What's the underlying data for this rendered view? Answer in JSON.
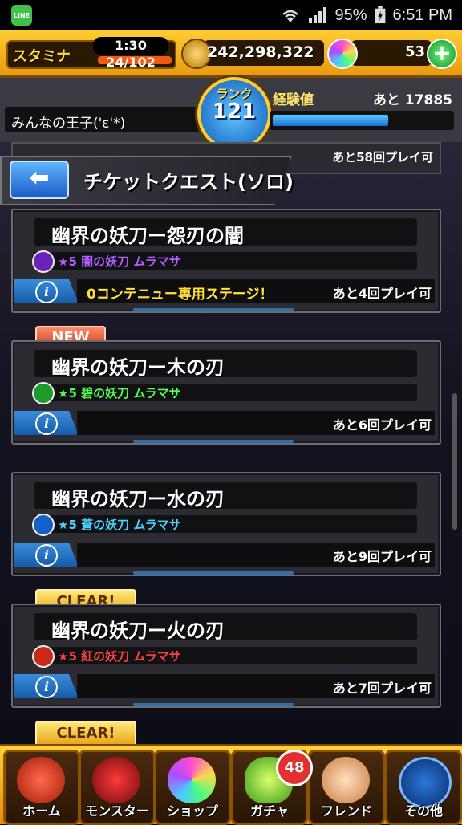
{
  "status_bar": {
    "line_app": "LINE",
    "battery": "95%",
    "time": "6:51 PM"
  },
  "header": {
    "stamina_label": "スタミナ",
    "stamina_timer": "1:30",
    "stamina_value": "24/102",
    "coins": "242,298,322",
    "orbs": "53",
    "plus": "+"
  },
  "user": {
    "name": "みんなの王子('ε'*)",
    "rank_label": "ランク",
    "rank_value": "121",
    "exp_label": "経験値",
    "exp_remaining": "あと 17885",
    "exp_progress": 0.65
  },
  "quest_list": {
    "top_strip_plays": "あと58回プレイ可",
    "back_arrow": "⬅",
    "screen_title": "チケットクエスト(ソロ)",
    "cards": [
      {
        "title": "幽界の妖刀ー怨刃の闇",
        "monster": "★5 闇の妖刀 ムラマサ",
        "element": "dark",
        "element_color": "#b35cff",
        "notice": "0コンテニュー専用ステージ！",
        "plays": "あと4回プレイ可",
        "tag": ""
      },
      {
        "title": "幽界の妖刀ー木の刃",
        "monster": "★5 碧の妖刀 ムラマサ",
        "element": "wood",
        "element_color": "#4dff4d",
        "notice": "",
        "plays": "あと6回プレイ可",
        "tag": "NEW"
      },
      {
        "title": "幽界の妖刀ー水の刃",
        "monster": "★5 蒼の妖刀 ムラマサ",
        "element": "water",
        "element_color": "#4dd2ff",
        "notice": "",
        "plays": "あと9回プレイ可",
        "tag": ""
      },
      {
        "title": "幽界の妖刀ー火の刃",
        "monster": "★5 紅の妖刀 ムラマサ",
        "element": "fire",
        "element_color": "#ff4040",
        "notice": "",
        "plays": "あと7回プレイ可",
        "tag": "CLEAR!"
      }
    ],
    "next_tag": "CLEAR!",
    "info_glyph": "i"
  },
  "nav": {
    "home": "ホーム",
    "monster": "モンスター",
    "shop": "ショップ",
    "gacha": "ガチャ",
    "gacha_badge": "48",
    "friend": "フレンド",
    "other": "その他"
  }
}
